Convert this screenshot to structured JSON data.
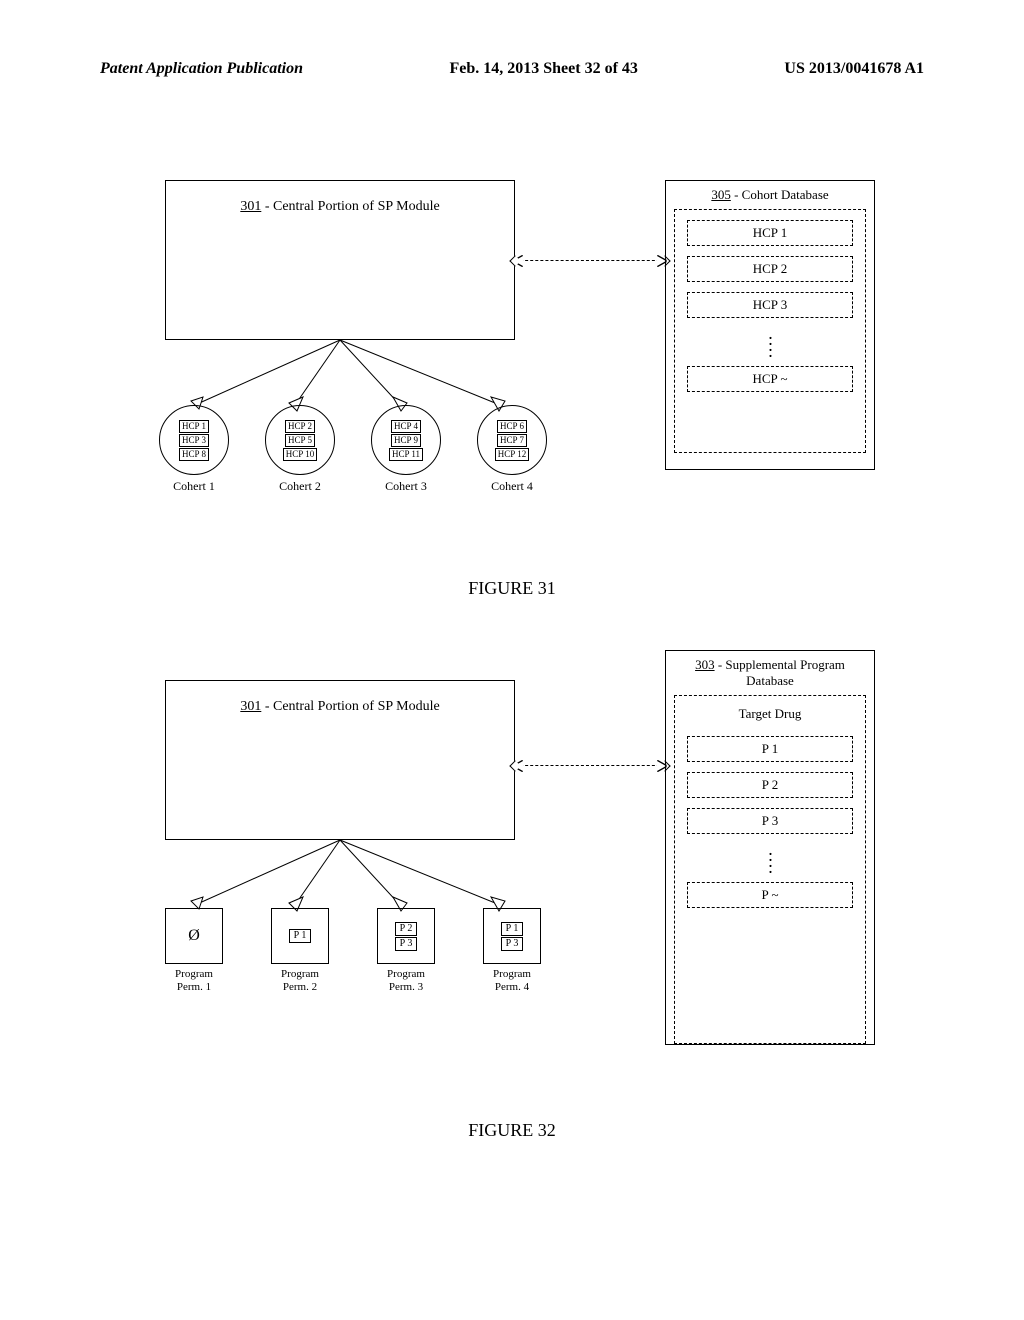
{
  "header": {
    "left": "Patent Application Publication",
    "center": "Feb. 14, 2013  Sheet 32 of 43",
    "right": "US 2013/0041678 A1"
  },
  "fig31": {
    "sp_module_ref": "301",
    "sp_module_label": " - Central Portion of SP Module",
    "db_ref": "305",
    "db_label": " - Cohort Database",
    "db_items": [
      "HCP 1",
      "HCP 2",
      "HCP 3"
    ],
    "db_last": "HCP ~",
    "cohorts": [
      {
        "label": "Cohert 1",
        "tags": [
          "HCP 1",
          "HCP 3",
          "HCP 8"
        ]
      },
      {
        "label": "Cohert 2",
        "tags": [
          "HCP 2",
          "HCP 5",
          "HCP 10"
        ]
      },
      {
        "label": "Cohert 3",
        "tags": [
          "HCP 4",
          "HCP 9",
          "HCP 11"
        ]
      },
      {
        "label": "Cohert 4",
        "tags": [
          "HCP 6",
          "HCP 7",
          "HCP 12"
        ]
      }
    ],
    "caption": "FIGURE  31"
  },
  "fig32": {
    "sp_module_ref": "301",
    "sp_module_label": " - Central Portion of SP Module",
    "db_ref": "303",
    "db_label": " - Supplemental Program Database",
    "db_inner_title": "Target Drug",
    "db_items": [
      "P 1",
      "P 2",
      "P 3"
    ],
    "db_last": "P ~",
    "perms": [
      {
        "label1": "Program",
        "label2": "Perm. 1",
        "tags": [],
        "symbol": "Ø"
      },
      {
        "label1": "Program",
        "label2": "Perm. 2",
        "tags": [
          "P 1"
        ]
      },
      {
        "label1": "Program",
        "label2": "Perm. 3",
        "tags": [
          "P 2",
          "P 3"
        ]
      },
      {
        "label1": "Program",
        "label2": "Perm. 4",
        "tags": [
          "P 1",
          "P 3"
        ]
      }
    ],
    "caption": "FIGURE  32"
  }
}
